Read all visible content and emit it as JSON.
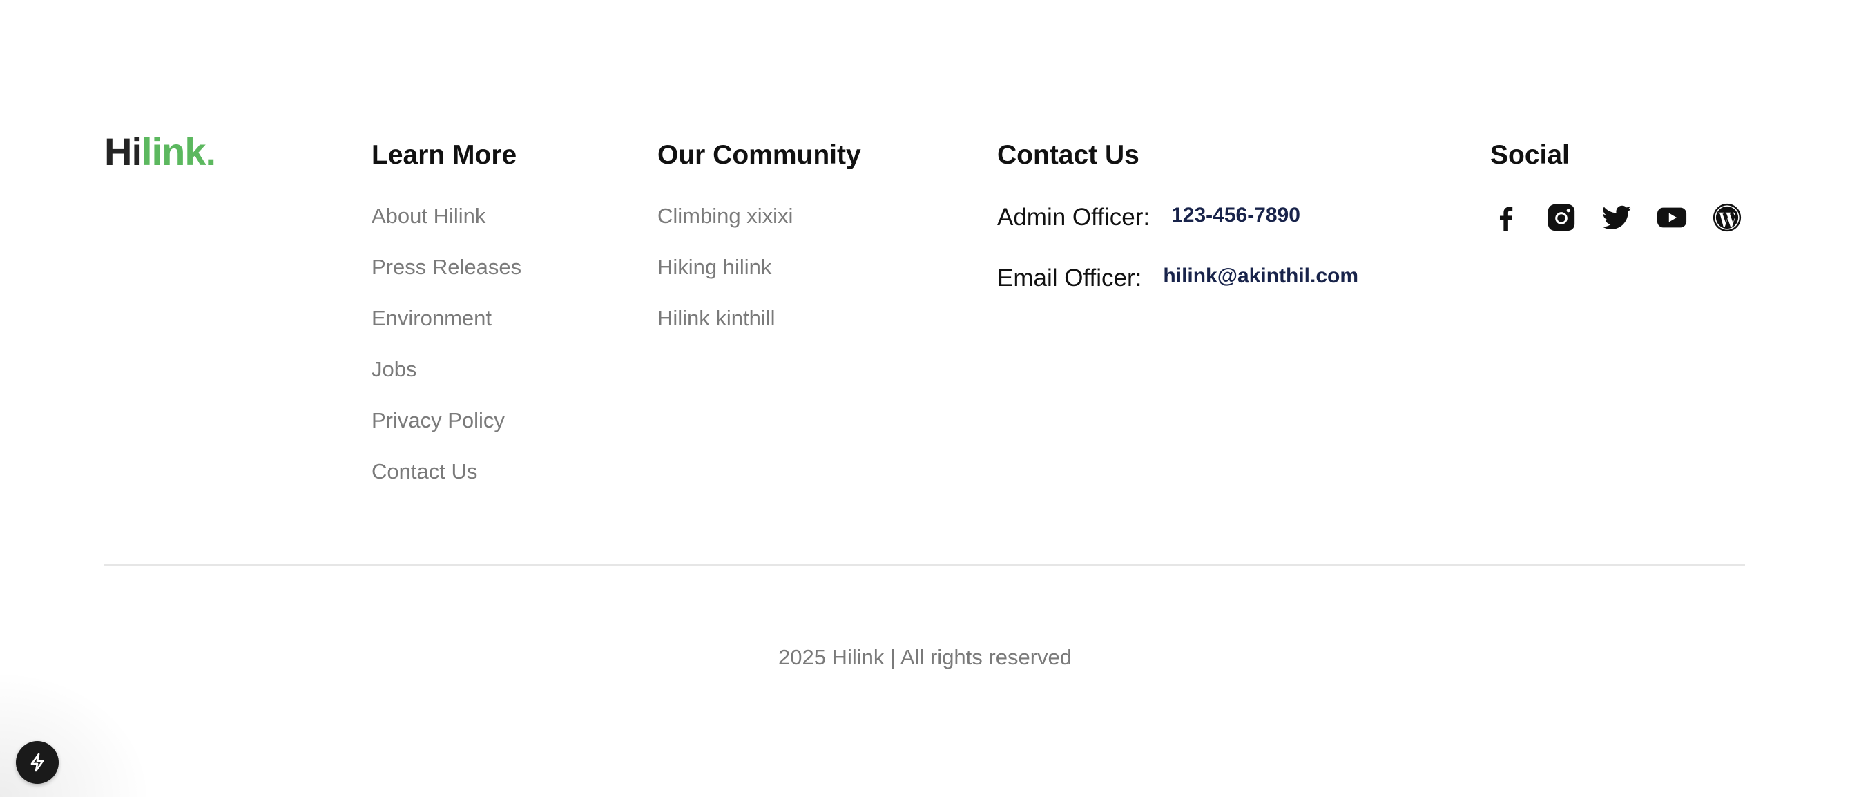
{
  "brand": {
    "logo_main": "Hi",
    "logo_accent": "link.",
    "accent_color": "#5cb85f",
    "text_color": "#242424"
  },
  "learn_more": {
    "heading": "Learn More",
    "links": [
      "About Hilink",
      "Press Releases",
      "Environment",
      "Jobs",
      "Privacy Policy",
      "Contact Us"
    ]
  },
  "community": {
    "heading": "Our Community",
    "links": [
      "Climbing xixixi",
      "Hiking hilink",
      "Hilink kinthill"
    ]
  },
  "contact": {
    "heading": "Contact Us",
    "admin_label": "Admin Officer:",
    "admin_value": "123-456-7890",
    "email_label": "Email Officer:",
    "email_value": "hilink@akinthil.com",
    "value_color": "#18234a"
  },
  "social": {
    "heading": "Social",
    "icons": [
      "facebook-icon",
      "instagram-icon",
      "twitter-icon",
      "youtube-icon",
      "wordpress-icon"
    ]
  },
  "footer": {
    "copyright": "2025 Hilink | All rights reserved"
  },
  "floating_button": {
    "icon": "lightning-bolt-icon"
  }
}
